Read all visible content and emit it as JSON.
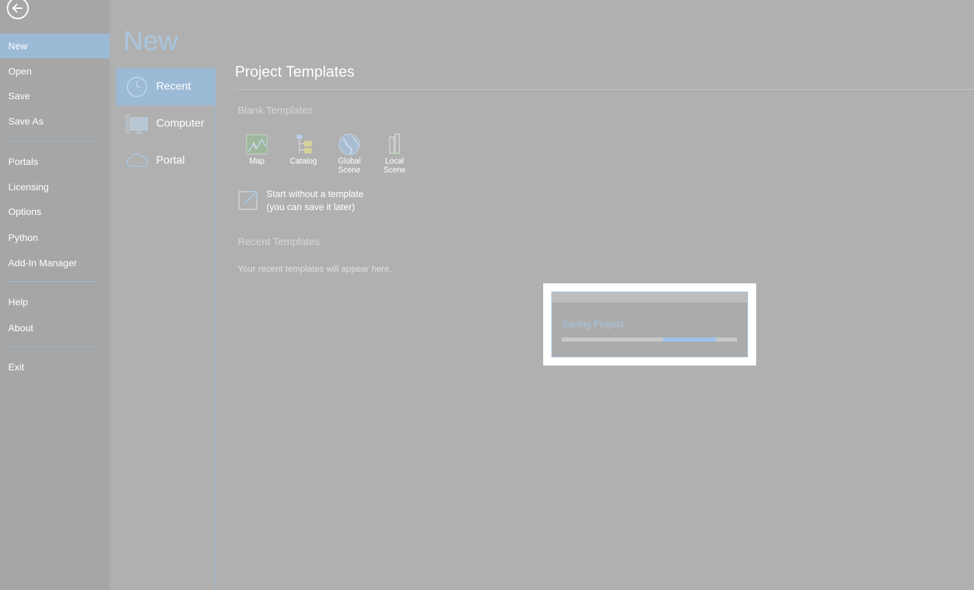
{
  "nav": {
    "items": [
      {
        "label": "New",
        "selected": true
      },
      {
        "label": "Open"
      },
      {
        "label": "Save"
      },
      {
        "label": "Save As"
      },
      {
        "label": "Portals"
      },
      {
        "label": "Licensing"
      },
      {
        "label": "Options"
      },
      {
        "label": "Python"
      },
      {
        "label": "Add-In Manager"
      },
      {
        "label": "Help"
      },
      {
        "label": "About"
      },
      {
        "label": "Exit"
      }
    ]
  },
  "page": {
    "title": "New",
    "locations": [
      {
        "label": "Recent",
        "icon": "clock-icon",
        "selected": true
      },
      {
        "label": "Computer",
        "icon": "computer-icon"
      },
      {
        "label": "Portal",
        "icon": "cloud-icon"
      }
    ]
  },
  "content": {
    "section_title": "Project Templates",
    "blank_templates_title": "Blank Templates",
    "templates": [
      {
        "label": "Map",
        "icon": "map-icon"
      },
      {
        "label": "Catalog",
        "icon": "catalog-icon"
      },
      {
        "label": "Global Scene",
        "icon": "globe-icon"
      },
      {
        "label": "Local Scene",
        "icon": "local-scene-icon"
      }
    ],
    "start_without_line1": "Start without a template",
    "start_without_line2": "(you can save it later)",
    "recent_templates_title": "Recent Templates",
    "recent_hint": "Your recent templates will appear here."
  },
  "dialog": {
    "message": "Saving Project",
    "progress_segment": {
      "start": 0.58,
      "end": 0.88
    }
  },
  "colors": {
    "accent": "#9bbad6",
    "overlay_bg": "#b0b0b0",
    "progress": "#9bc4ec"
  }
}
